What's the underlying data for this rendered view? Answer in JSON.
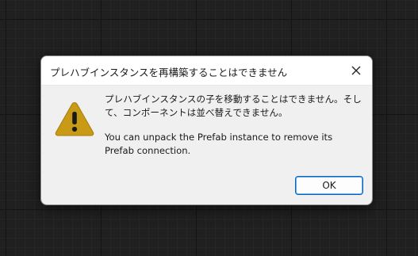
{
  "dialog": {
    "title": "プレハブインスタンスを再構築することはできません",
    "message_jp": "プレハブインスタンスの子を移動することはできません。そして、コンポーネントは並べ替えできません。",
    "message_en": "You can unpack the Prefab instance to remove its Prefab connection.",
    "ok_label": "OK",
    "icon": "warning-icon",
    "close_icon": "close-icon"
  },
  "colors": {
    "warning_fill": "#c89a16",
    "accent": "#0067c0",
    "dialog_bg": "#f0f0f0",
    "title_bg": "#ffffff",
    "canvas_bg": "#202020"
  }
}
